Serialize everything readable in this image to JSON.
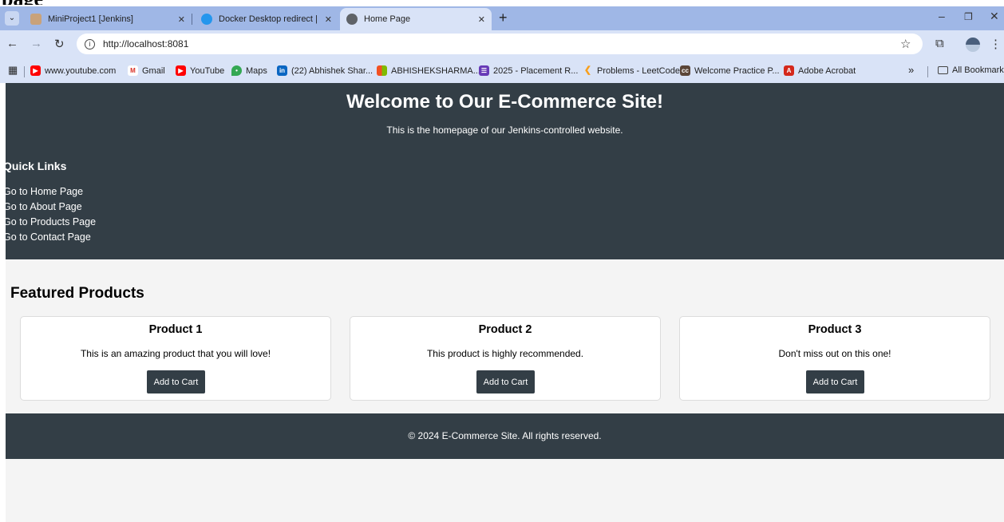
{
  "doc_crop_text": "page",
  "browser": {
    "tabs": [
      {
        "title": "MiniProject1 [Jenkins]",
        "close": "✕"
      },
      {
        "title": "Docker Desktop redirect | Dock",
        "close": "✕"
      },
      {
        "title": "Home Page",
        "close": "✕"
      }
    ],
    "new_tab": "+",
    "url": "http://localhost:8081",
    "bookmarks": [
      "www.youtube.com",
      "Gmail",
      "YouTube",
      "Maps",
      "(22) Abhishek Shar...",
      "ABHISHEKSHARMA...",
      "2025 - Placement R...",
      "Problems - LeetCode",
      "Welcome Practice P...",
      "Adobe Acrobat"
    ],
    "more_bookmarks": "»",
    "all_bookmarks": "All Bookmarks"
  },
  "page": {
    "hero_title": "Welcome to Our E-Commerce Site!",
    "hero_subtitle": "This is the homepage of our Jenkins-controlled website.",
    "quick_links_heading": "Quick Links",
    "quick_links": [
      "Go to Home Page",
      "Go to About Page",
      "Go to Products Page",
      "Go to Contact Page"
    ],
    "featured_heading": "Featured Products",
    "products": [
      {
        "name": "Product 1",
        "description": "This is an amazing product that you will love!",
        "button": "Add to Cart"
      },
      {
        "name": "Product 2",
        "description": "This product is highly recommended.",
        "button": "Add to Cart"
      },
      {
        "name": "Product 3",
        "description": "Don't miss out on this one!",
        "button": "Add to Cart"
      }
    ],
    "footer": "© 2024 E-Commerce Site. All rights reserved."
  },
  "colors": {
    "header_bg": "#333e46",
    "page_bg": "#f4f4f4",
    "tabstrip_bg": "#9fb7e6",
    "toolbar_bg": "#d9e3f7"
  }
}
